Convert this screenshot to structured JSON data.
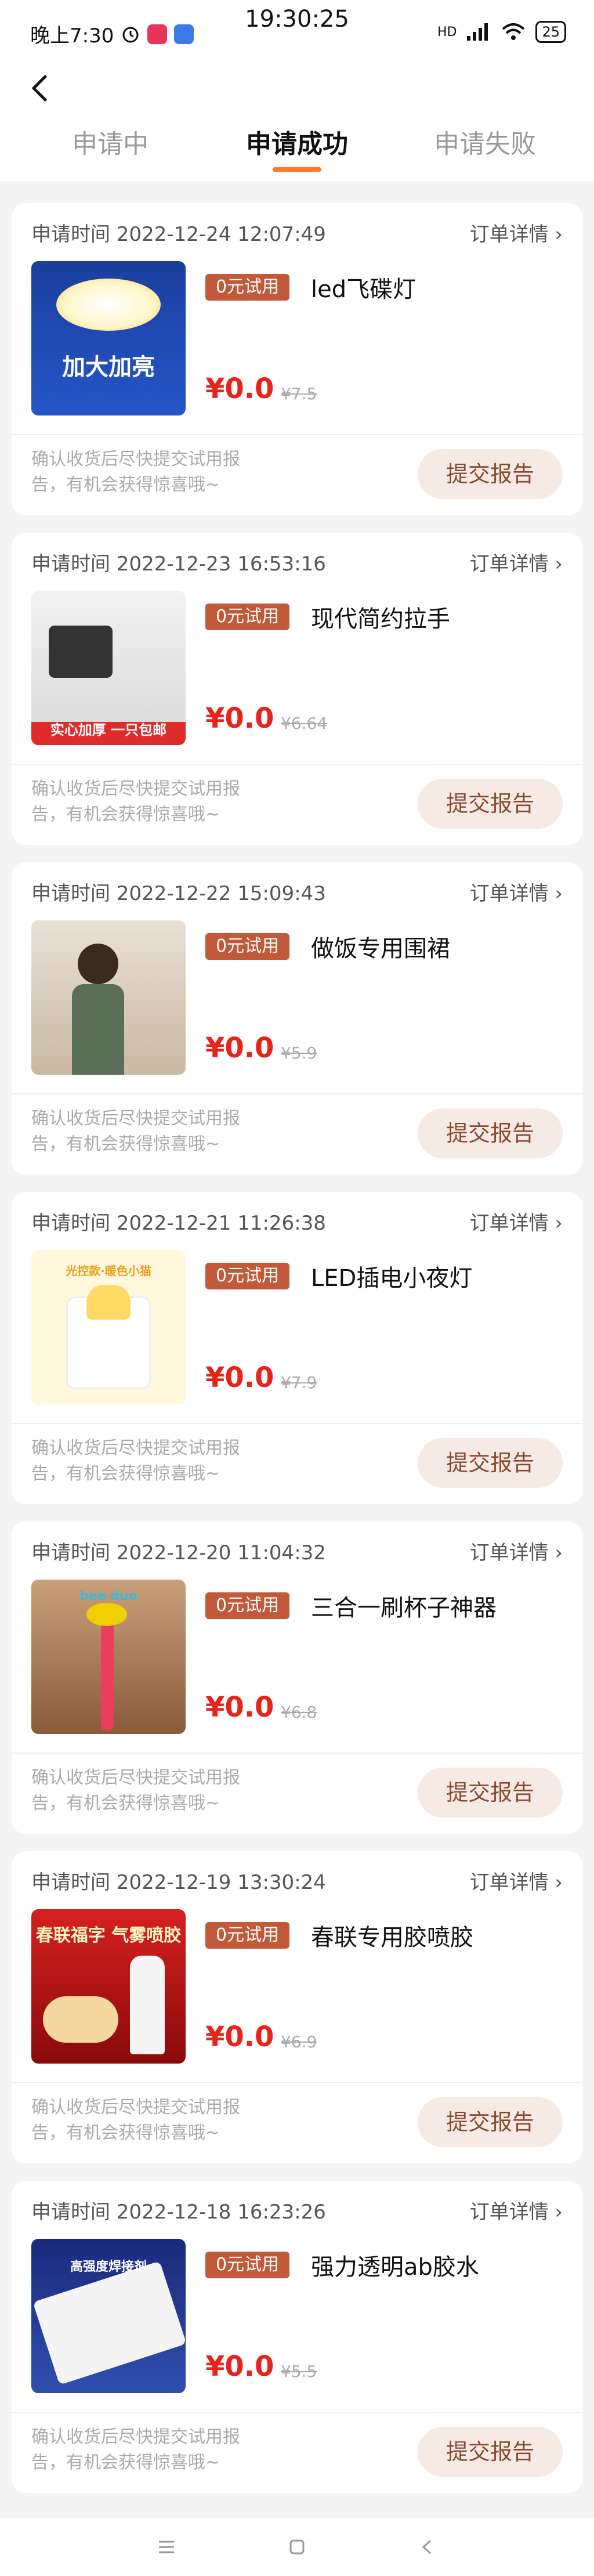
{
  "status_bar": {
    "left_text": "晚上7:30",
    "time": "19:30:25",
    "network_label": "HD",
    "battery": "25",
    "alarm_icon": "alarm-icon",
    "app_icon_colors": [
      "#e8345a",
      "#3a7be8"
    ]
  },
  "nav": {
    "back_icon": "back-arrow-icon",
    "tabs": [
      {
        "label": "申请中",
        "active": false
      },
      {
        "label": "申请成功",
        "active": true
      },
      {
        "label": "申请失败",
        "active": false
      }
    ],
    "accent_color": "#ff7a2e"
  },
  "cards": [
    {
      "time": "申请时间 2022-12-24 12:07:49",
      "detail": "订单详情 ›",
      "badge": "0元试用",
      "name": "led飞碟灯",
      "price": "¥0.0",
      "orig_price": "¥7.5",
      "tip": "确认收货后尽快提交试用报告，有机会获得惊喜哦~",
      "button": "提交报告",
      "thumb_text": "加大加亮"
    },
    {
      "time": "申请时间 2022-12-23 16:53:16",
      "detail": "订单详情 ›",
      "badge": "0元试用",
      "name": "现代简约拉手",
      "price": "¥0.0",
      "orig_price": "¥6.64",
      "tip": "确认收货后尽快提交试用报告，有机会获得惊喜哦~",
      "button": "提交报告",
      "thumb_text": "实心加厚 一只包邮"
    },
    {
      "time": "申请时间 2022-12-22 15:09:43",
      "detail": "订单详情 ›",
      "badge": "0元试用",
      "name": "做饭专用围裙",
      "price": "¥0.0",
      "orig_price": "¥5.9",
      "tip": "确认收货后尽快提交试用报告，有机会获得惊喜哦~",
      "button": "提交报告",
      "thumb_text": ""
    },
    {
      "time": "申请时间 2022-12-21 11:26:38",
      "detail": "订单详情 ›",
      "badge": "0元试用",
      "name": "LED插电小夜灯",
      "price": "¥0.0",
      "orig_price": "¥7.9",
      "tip": "确认收货后尽快提交试用报告，有机会获得惊喜哦~",
      "button": "提交报告",
      "thumb_text": "光控款·暖色小猫"
    },
    {
      "time": "申请时间 2022-12-20 11:04:32",
      "detail": "订单详情 ›",
      "badge": "0元试用",
      "name": "三合一刷杯子神器",
      "price": "¥0.0",
      "orig_price": "¥6.8",
      "tip": "确认收货后尽快提交试用报告，有机会获得惊喜哦~",
      "button": "提交报告",
      "thumb_text": "bee duo"
    },
    {
      "time": "申请时间 2022-12-19 13:30:24",
      "detail": "订单详情 ›",
      "badge": "0元试用",
      "name": "春联专用胶喷胶",
      "price": "¥0.0",
      "orig_price": "¥6.9",
      "tip": "确认收货后尽快提交试用报告，有机会获得惊喜哦~",
      "button": "提交报告",
      "thumb_text": "春联福字 气雾喷胶"
    },
    {
      "time": "申请时间 2022-12-18 16:23:26",
      "detail": "订单详情 ›",
      "badge": "0元试用",
      "name": "强力透明ab胶水",
      "price": "¥0.0",
      "orig_price": "¥5.5",
      "tip": "确认收货后尽快提交试用报告，有机会获得惊喜哦~",
      "button": "提交报告",
      "thumb_text": "高强度焊接剂"
    }
  ],
  "bottom_nav": {
    "icons": [
      "menu-icon",
      "home-icon",
      "back-icon"
    ]
  }
}
